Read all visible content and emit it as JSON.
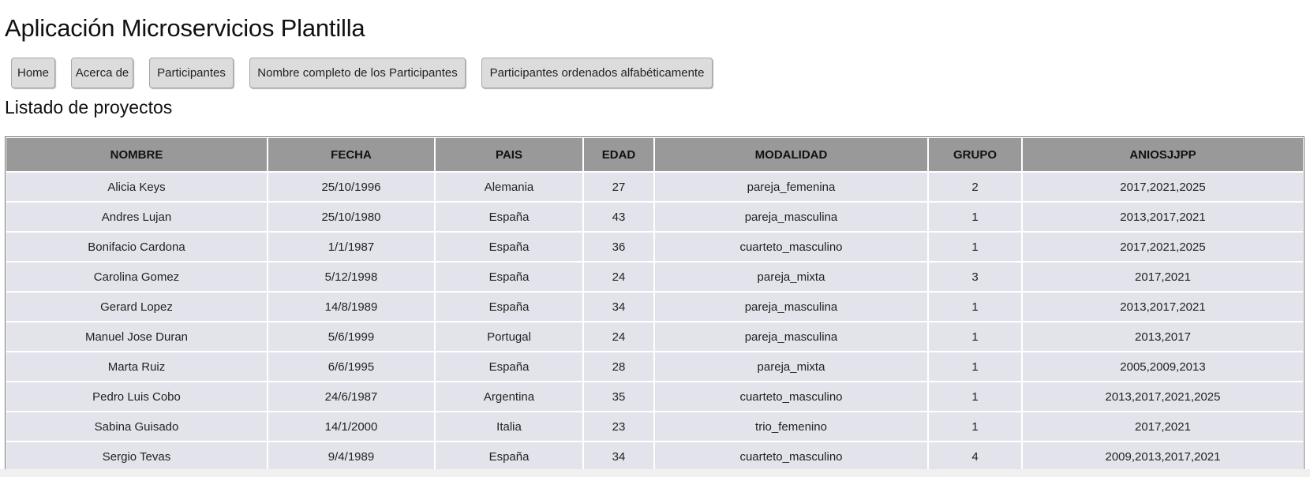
{
  "app": {
    "title": "Aplicación Microservicios Plantilla"
  },
  "nav": [
    {
      "label": "Home"
    },
    {
      "label": "Acerca de"
    },
    {
      "label": "Participantes"
    },
    {
      "label": "Nombre completo de los Participantes"
    },
    {
      "label": "Participantes ordenados alfabéticamente"
    }
  ],
  "section": {
    "title": "Listado de proyectos"
  },
  "table": {
    "headers": [
      "NOMBRE",
      "FECHA",
      "PAIS",
      "EDAD",
      "MODALIDAD",
      "GRUPO",
      "ANIOSJJPP"
    ],
    "rows": [
      [
        "Alicia Keys",
        "25/10/1996",
        "Alemania",
        "27",
        "pareja_femenina",
        "2",
        "2017,2021,2025"
      ],
      [
        "Andres Lujan",
        "25/10/1980",
        "España",
        "43",
        "pareja_masculina",
        "1",
        "2013,2017,2021"
      ],
      [
        "Bonifacio Cardona",
        "1/1/1987",
        "España",
        "36",
        "cuarteto_masculino",
        "1",
        "2017,2021,2025"
      ],
      [
        "Carolina Gomez",
        "5/12/1998",
        "España",
        "24",
        "pareja_mixta",
        "3",
        "2017,2021"
      ],
      [
        "Gerard Lopez",
        "14/8/1989",
        "España",
        "34",
        "pareja_masculina",
        "1",
        "2013,2017,2021"
      ],
      [
        "Manuel Jose Duran",
        "5/6/1999",
        "Portugal",
        "24",
        "pareja_masculina",
        "1",
        "2013,2017"
      ],
      [
        "Marta Ruiz",
        "6/6/1995",
        "España",
        "28",
        "pareja_mixta",
        "1",
        "2005,2009,2013"
      ],
      [
        "Pedro Luis Cobo",
        "24/6/1987",
        "Argentina",
        "35",
        "cuarteto_masculino",
        "1",
        "2013,2017,2021,2025"
      ],
      [
        "Sabina Guisado",
        "14/1/2000",
        "Italia",
        "23",
        "trio_femenino",
        "1",
        "2017,2021"
      ],
      [
        "Sergio Tevas",
        "9/4/1989",
        "España",
        "34",
        "cuarteto_masculino",
        "4",
        "2009,2013,2017,2021"
      ]
    ]
  },
  "colors": {
    "header_bg": "#999999",
    "cell_bg": "#e3e3ec",
    "button_bg": "#dcdcdc"
  }
}
